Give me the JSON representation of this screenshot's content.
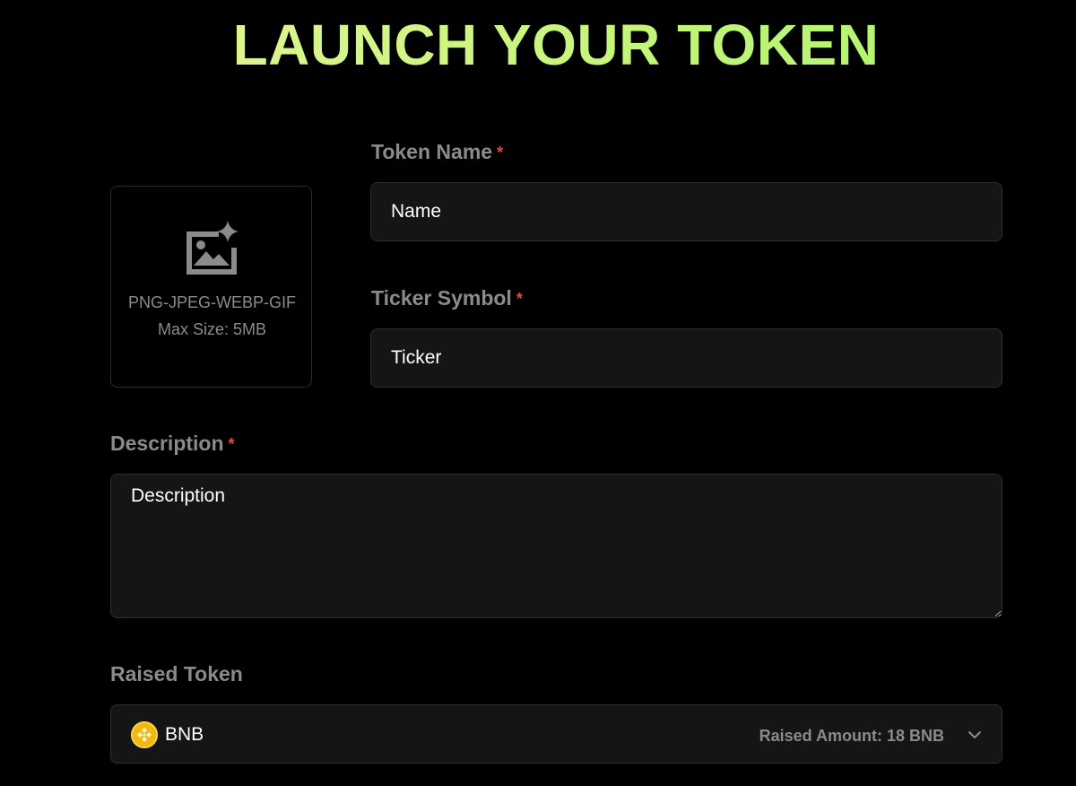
{
  "page": {
    "title": "LAUNCH YOUR TOKEN"
  },
  "upload": {
    "icon": "image-add-icon",
    "formats": "PNG-JPEG-WEBP-GIF",
    "max_size": "Max Size: 5MB"
  },
  "form": {
    "required_marker": "*",
    "token_name": {
      "label": "Token Name",
      "value": "",
      "placeholder": "Name"
    },
    "ticker": {
      "label": "Ticker Symbol",
      "value": "",
      "placeholder": "Ticker"
    },
    "description": {
      "label": "Description",
      "value": "",
      "placeholder": "Description"
    },
    "raised_token": {
      "label": "Raised Token",
      "selected": "BNB",
      "coin_icon": "bnb-coin-icon",
      "raised_amount": "Raised Amount: 18 BNB",
      "dropdown_icon": "chevron-down-icon"
    }
  },
  "colors": {
    "background": "#000000",
    "field_background": "#151515",
    "label": "#8b8b8b",
    "required": "#e8493b",
    "title_gradient_start": "#eaf59b",
    "title_gradient_end": "#a6f56a",
    "bnb": "#f0b90b"
  }
}
